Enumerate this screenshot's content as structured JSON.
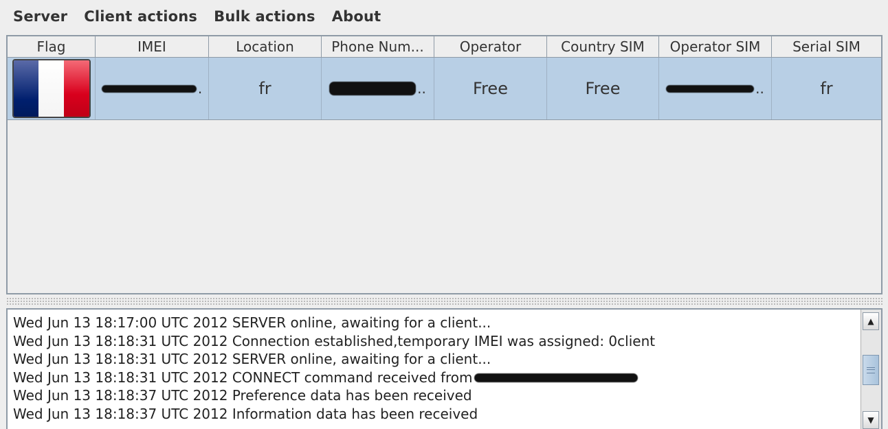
{
  "menu": [
    "Server",
    "Client actions",
    "Bulk actions",
    "About"
  ],
  "table": {
    "columns": [
      "Flag",
      "IMEI",
      "Location",
      "Phone Num...",
      "Operator",
      "Country SIM",
      "Operator SIM",
      "Serial SIM"
    ],
    "rows": [
      {
        "flag_icon": "france-flag-icon",
        "location": "fr",
        "operator": "Free",
        "country_sim": "Free",
        "serial_sim": "fr",
        "ellipsis": ".",
        "ellipsis2": ".."
      }
    ]
  },
  "log": {
    "lines": [
      "Wed Jun 13 18:17:00 UTC 2012 SERVER online, awaiting for a client...",
      "Wed Jun 13 18:18:31 UTC 2012 Connection established,temporary IMEI was assigned: 0client",
      "Wed Jun 13 18:18:31 UTC 2012 SERVER online, awaiting for a client...",
      "Wed Jun 13 18:18:31 UTC 2012 CONNECT command received from",
      "Wed Jun 13 18:18:37 UTC 2012 Preference data has been received",
      "Wed Jun 13 18:18:37 UTC 2012 Information data has been received"
    ]
  },
  "colors": {
    "selected_row": "#b8cfe5",
    "border": "#8e9aa6",
    "background": "#eeeeee"
  }
}
